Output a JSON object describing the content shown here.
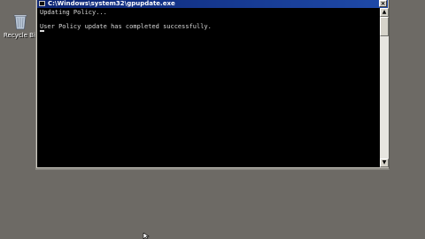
{
  "desktop": {
    "background_color": "#6d6a65",
    "icons": [
      {
        "label": "Recycle Bin",
        "icon": "recycle-bin-icon"
      }
    ]
  },
  "window": {
    "title": "C:\\Windows\\system32\\gpupdate.exe",
    "app_icon": "console-icon",
    "close_label": "×",
    "titlebar_color": "#0b2473",
    "console": {
      "lines": [
        "Updating Policy...",
        "",
        "User Policy update has completed successfully."
      ],
      "cursor_glyph": "_",
      "background": "#000000",
      "foreground": "#d9d9d9"
    },
    "scrollbar": {
      "up_arrow": "▲",
      "down_arrow": "▼"
    }
  },
  "pointer": {
    "icon": "mouse-pointer-icon"
  }
}
